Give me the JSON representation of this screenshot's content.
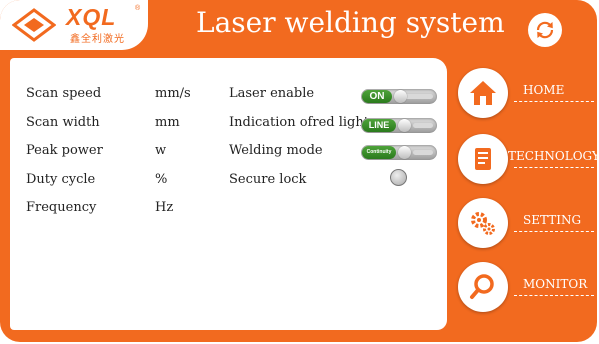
{
  "brand": {
    "name": "XQL",
    "registered_mark": "®",
    "subtitle": "鑫全利激光"
  },
  "header": {
    "title": "Laser welding system"
  },
  "parameters": [
    {
      "label": "Scan speed",
      "unit": "mm/s"
    },
    {
      "label": "Scan width",
      "unit": "mm"
    },
    {
      "label": "Peak power",
      "unit": "w"
    },
    {
      "label": "Duty cycle",
      "unit": "%"
    },
    {
      "label": "Frequency",
      "unit": "Hz"
    }
  ],
  "toggles": [
    {
      "label": "Laser enable",
      "state_text": "ON"
    },
    {
      "label": "Indication ofred light",
      "state_text": "LINE"
    },
    {
      "label": "Welding mode",
      "state_text": "Continuity"
    },
    {
      "label": "Secure lock"
    }
  ],
  "nav": [
    {
      "label": "HOME",
      "icon": "home-icon"
    },
    {
      "label": "TECHNOLOGY",
      "icon": "document-icon"
    },
    {
      "label": "SETTING",
      "icon": "gears-icon"
    },
    {
      "label": "MONITOR",
      "icon": "magnifier-icon"
    }
  ],
  "colors": {
    "accent": "#f26a1f",
    "toggle_on": "#2f8a21",
    "panel": "#ffffff"
  }
}
